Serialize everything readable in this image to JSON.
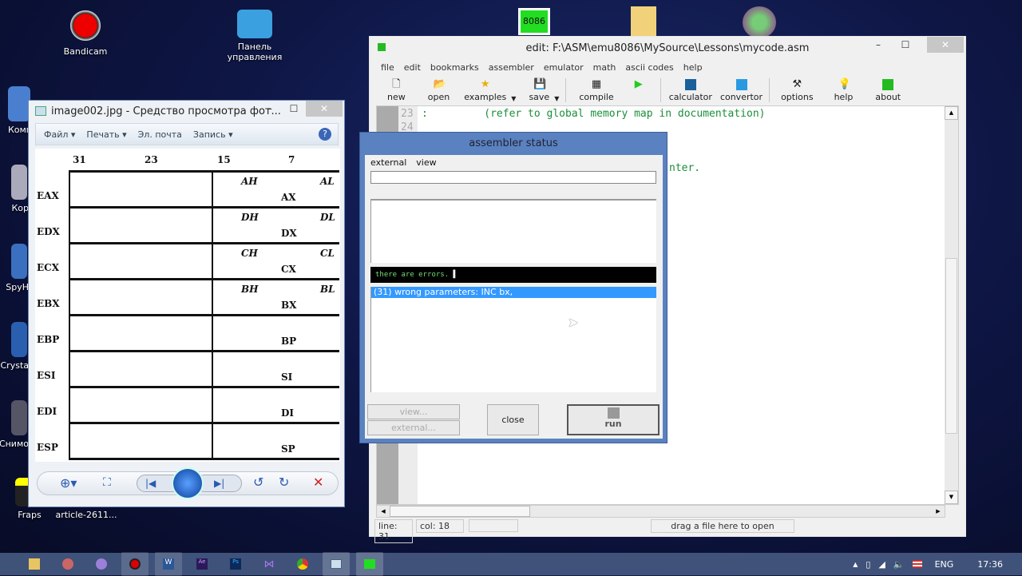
{
  "desktop": {
    "icons": [
      {
        "label": "Bandicam",
        "name": "bandicam"
      },
      {
        "label": "Панель управления",
        "name": "control-panel"
      },
      {
        "label": "Комп",
        "name": "computer"
      },
      {
        "label": "Кор",
        "name": "recycle-bin"
      },
      {
        "label": "SpyH",
        "name": "spyhunter"
      },
      {
        "label": "Crysta",
        "name": "crystal"
      },
      {
        "label": "Снимо",
        "name": "snapshot"
      },
      {
        "label": "Fraps",
        "name": "fraps"
      },
      {
        "label": "article-2611...",
        "name": "article"
      },
      {
        "label": "8086",
        "name": "emu8086"
      }
    ]
  },
  "viewer": {
    "title": "image002.jpg - Средство просмотра фот...",
    "menu": [
      "Файл",
      "Печать",
      "Эл. почта",
      "Запись"
    ],
    "bits": [
      "31",
      "23",
      "15",
      "7"
    ],
    "registers": [
      {
        "name": "EAX",
        "hi": "AH",
        "lo": "AL",
        "w": "AX"
      },
      {
        "name": "EDX",
        "hi": "DH",
        "lo": "DL",
        "w": "DX"
      },
      {
        "name": "ECX",
        "hi": "CH",
        "lo": "CL",
        "w": "CX"
      },
      {
        "name": "EBX",
        "hi": "BH",
        "lo": "BL",
        "w": "BX"
      },
      {
        "name": "EBP",
        "hi": "",
        "lo": "",
        "w": "BP"
      },
      {
        "name": "ESI",
        "hi": "",
        "lo": "",
        "w": "SI"
      },
      {
        "name": "EDI",
        "hi": "",
        "lo": "",
        "w": "DI"
      },
      {
        "name": "ESP",
        "hi": "",
        "lo": "",
        "w": "SP"
      }
    ]
  },
  "editor": {
    "title": "edit: F:\\ASM\\emu8086\\MySource\\Lessons\\mycode.asm",
    "menu": [
      "file",
      "edit",
      "bookmarks",
      "assembler",
      "emulator",
      "math",
      "ascii codes",
      "help"
    ],
    "toolbar": {
      "new": "new",
      "open": "open",
      "examples": "examples",
      "save": "save",
      "compile": "compile",
      "calculator": "calculator",
      "convertor": "convertor",
      "options": "options",
      "help": "help",
      "about": "about"
    },
    "lines": [
      {
        "n": "23",
        "text": ":         (refer to global memory map in documentation)"
      },
      {
        "n": "24",
        "text": ""
      }
    ],
    "partial_text": "nter.",
    "status": {
      "line": "line: 31",
      "col": "col: 18",
      "hint": "drag a file here to open"
    }
  },
  "dialog": {
    "title": "assembler status",
    "menu": [
      "external",
      "view"
    ],
    "message": "there are errors.",
    "errors": [
      "(31) wrong parameters: INC  bx,"
    ],
    "buttons": {
      "view": "view...",
      "external": "external...",
      "close": "close",
      "run": "run"
    }
  },
  "taskbar": {
    "lang": "ENG",
    "time": "17:36"
  }
}
